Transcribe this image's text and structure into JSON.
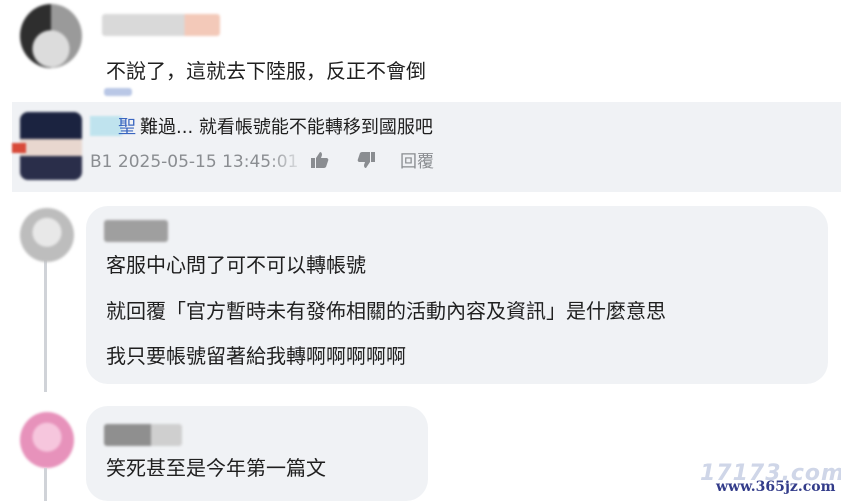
{
  "comment1": {
    "text": "不說了，這就去下陸服，反正不會倒"
  },
  "reply": {
    "name_tail": "聖",
    "text": "難過... 就看帳號能不能轉移到國服吧",
    "meta": "B1  2025-05-15 13:45:01",
    "reply_label": "回覆",
    "like_icon": "thumbs-up-icon",
    "dislike_icon": "thumbs-down-icon"
  },
  "comment2": {
    "lines": [
      "客服中心問了可不可以轉帳號",
      "就回覆「官方暫時未有發佈相關的活動內容及資訊」是什麼意思",
      "我只要帳號留著給我轉啊啊啊啊啊"
    ]
  },
  "comment3": {
    "text": "笑死甚至是今年第一篇文"
  },
  "watermark": {
    "logo": "17173.com",
    "url": "www.365jz.com"
  },
  "colors": {
    "bubble": "#f0f2f5",
    "meta": "#8a8d91",
    "link": "#3a66c0"
  }
}
